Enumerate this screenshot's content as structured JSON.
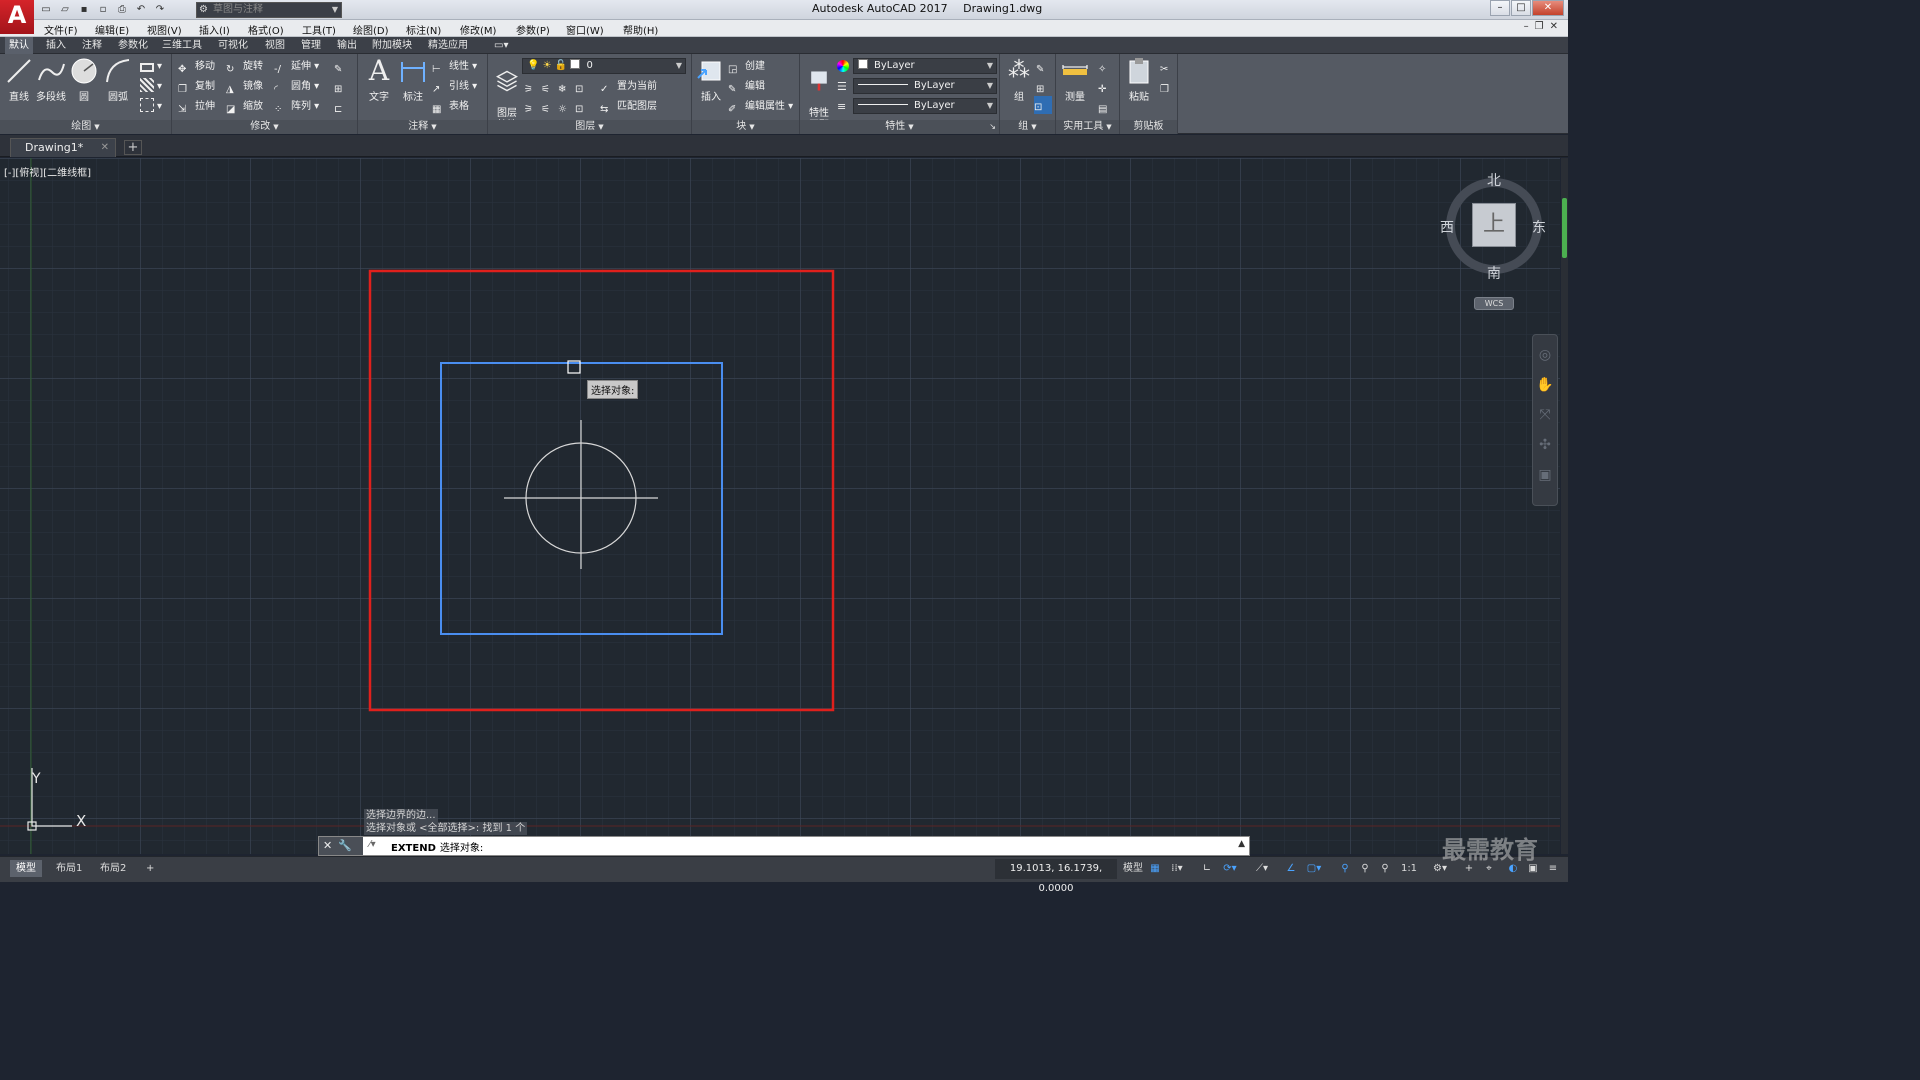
{
  "titlebar": {
    "app_name": "Autodesk AutoCAD 2017",
    "file_name": "Drawing1.dwg",
    "workspace": "草图与注释",
    "logo_letter": "A"
  },
  "menu": {
    "items": [
      "文件(F)",
      "编辑(E)",
      "视图(V)",
      "插入(I)",
      "格式(O)",
      "工具(T)",
      "绘图(D)",
      "标注(N)",
      "修改(M)",
      "参数(P)",
      "窗口(W)",
      "帮助(H)"
    ]
  },
  "ribbon_tabs": {
    "items": [
      "默认",
      "插入",
      "注释",
      "参数化",
      "三维工具",
      "可视化",
      "视图",
      "管理",
      "输出",
      "附加模块",
      "精选应用"
    ],
    "active_index": 0
  },
  "ribbon": {
    "draw": {
      "title": "绘图",
      "line": "直线",
      "polyline": "多段线",
      "circle": "圆",
      "arc": "圆弧"
    },
    "modify": {
      "title": "修改",
      "move": "移动",
      "rotate": "旋转",
      "trim": "延伸",
      "copy": "复制",
      "mirror": "镜像",
      "fillet": "圆角",
      "stretch": "拉伸",
      "scale": "缩放",
      "array": "阵列"
    },
    "annotation": {
      "title": "注释",
      "text": "文字",
      "dimension": "标注",
      "linear": "线性",
      "leader": "引线",
      "table": "表格"
    },
    "layers": {
      "title": "图层",
      "properties": "图层\n特性",
      "current_layer": "0",
      "make_current": "置为当前",
      "match_layer": "匹配图层"
    },
    "block": {
      "title": "块",
      "insert": "插入",
      "create": "创建",
      "edit": "编辑",
      "edit_attributes": "编辑属性"
    },
    "properties": {
      "title": "特性",
      "match": "特性\n匹配",
      "color": "ByLayer",
      "linetype": "ByLayer",
      "lineweight": "ByLayer"
    },
    "groups": {
      "title": "组",
      "group": "组"
    },
    "utilities": {
      "title": "实用工具",
      "measure": "测量"
    },
    "clipboard": {
      "title": "剪贴板",
      "paste": "粘贴"
    }
  },
  "document_tabs": {
    "active": "Drawing1*",
    "new_tab_symbol": "+"
  },
  "viewport": {
    "label": "[-][俯视][二维线框]",
    "cursor_tooltip": "选择对象:",
    "ucs_x": "X",
    "ucs_y": "Y",
    "colors": {
      "background": "#212830",
      "outer_rect": "#e0201c",
      "selected_rect": "#4a8ef0",
      "circle": "#d8d8d8"
    }
  },
  "viewcube": {
    "north": "北",
    "south": "南",
    "east": "东",
    "west": "西",
    "face": "上",
    "wcs": "WCS"
  },
  "command": {
    "history": [
      "选择边界的边...",
      "选择对象或 <全部选择>:  找到 1 个"
    ],
    "command_name": "EXTEND",
    "prompt": "选择对象:"
  },
  "statusbar": {
    "layout_tabs": [
      "模型",
      "布局1",
      "布局2"
    ],
    "active_layout": 0,
    "add_layout": "+",
    "coordinates": "19.1013, 16.1739, 0.0000",
    "model_label": "模型",
    "scale": "1:1"
  },
  "watermark": "最需教育"
}
